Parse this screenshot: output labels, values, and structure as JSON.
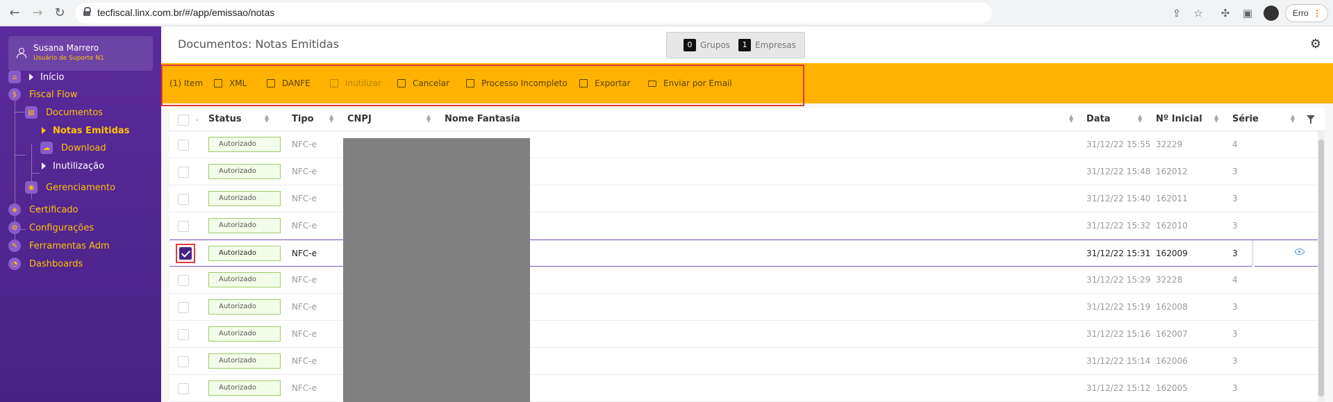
{
  "browser": {
    "url": "tecfiscal.linx.com.br/#/app/emissao/notas",
    "error_label": "Erro"
  },
  "user": {
    "name": "Susana Marrero",
    "role": "Usuário de Suporte N1"
  },
  "sidebar": {
    "items": [
      {
        "label": "Início"
      },
      {
        "label": "Fiscal Flow"
      },
      {
        "label": "Documentos"
      },
      {
        "label": "Notas Emitidas"
      },
      {
        "label": "Download"
      },
      {
        "label": "Inutilização"
      },
      {
        "label": "Gerenciamento"
      },
      {
        "label": "Certificado"
      },
      {
        "label": "Configurações"
      },
      {
        "label": "Ferramentas Adm"
      },
      {
        "label": "Dashboards"
      }
    ]
  },
  "header": {
    "title": "Documentos: Notas Emitidas",
    "groups_count": "0",
    "groups_label": "Grupos",
    "companies_count": "1",
    "companies_label": "Empresas"
  },
  "toolbar": {
    "item_count": "(1) Item",
    "xml": "XML",
    "danfe": "DANFE",
    "inutilizar": "Inutilizar",
    "cancelar": "Cancelar",
    "processo": "Processo Incompleto",
    "exportar": "Exportar",
    "email": "Enviar por Email"
  },
  "table": {
    "headers": {
      "status": "Status",
      "tipo": "Tipo",
      "cnpj": "CNPJ",
      "nome": "Nome Fantasia",
      "data": "Data",
      "numero": "Nº Inicial",
      "serie": "Série"
    },
    "rows": [
      {
        "status": "Autorizado",
        "tipo": "NFC-e",
        "data": "31/12/22 15:55",
        "numero": "32229",
        "serie": "4"
      },
      {
        "status": "Autorizado",
        "tipo": "NFC-e",
        "data": "31/12/22 15:48",
        "numero": "162012",
        "serie": "3"
      },
      {
        "status": "Autorizado",
        "tipo": "NFC-e",
        "data": "31/12/22 15:40",
        "numero": "162011",
        "serie": "3"
      },
      {
        "status": "Autorizado",
        "tipo": "NFC-e",
        "data": "31/12/22 15:32",
        "numero": "162010",
        "serie": "3"
      },
      {
        "status": "Autorizado",
        "tipo": "NFC-e",
        "data": "31/12/22 15:31",
        "numero": "162009",
        "serie": "3"
      },
      {
        "status": "Autorizado",
        "tipo": "NFC-e",
        "data": "31/12/22 15:29",
        "numero": "32228",
        "serie": "4"
      },
      {
        "status": "Autorizado",
        "tipo": "NFC-e",
        "data": "31/12/22 15:19",
        "numero": "162008",
        "serie": "3"
      },
      {
        "status": "Autorizado",
        "tipo": "NFC-e",
        "data": "31/12/22 15:16",
        "numero": "162007",
        "serie": "3"
      },
      {
        "status": "Autorizado",
        "tipo": "NFC-e",
        "data": "31/12/22 15:14",
        "numero": "162006",
        "serie": "3"
      },
      {
        "status": "Autorizado",
        "tipo": "NFC-e",
        "data": "31/12/22 15:12",
        "numero": "162005",
        "serie": "3"
      }
    ]
  },
  "colors": {
    "sidebar": "#5b2a9c",
    "accent": "#ffc107",
    "toolbar": "#ffb300",
    "highlight": "#e53935"
  }
}
